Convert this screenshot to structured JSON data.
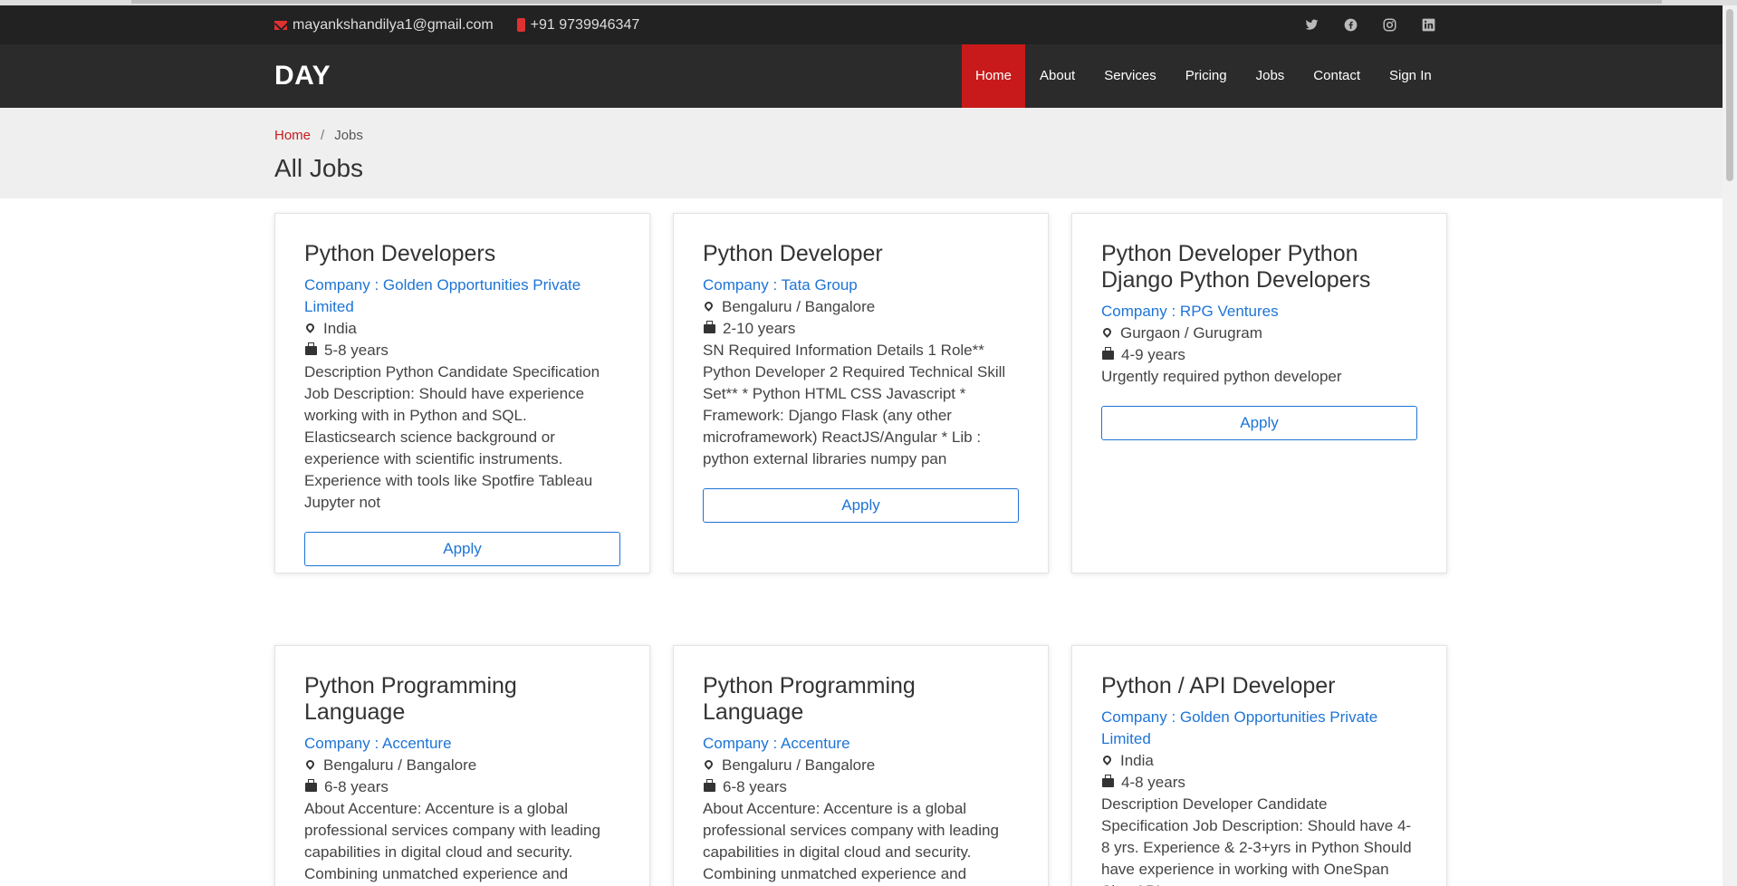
{
  "topbar": {
    "email": "mayankshandilya1@gmail.com",
    "phone": "+91 9739946347",
    "social": [
      "twitter-icon",
      "facebook-icon",
      "instagram-icon",
      "linkedin-icon"
    ]
  },
  "navbar": {
    "logo": "DAY",
    "items": [
      {
        "label": "Home",
        "active": true
      },
      {
        "label": "About"
      },
      {
        "label": "Services"
      },
      {
        "label": "Pricing"
      },
      {
        "label": "Jobs"
      },
      {
        "label": "Contact"
      },
      {
        "label": "Sign In"
      }
    ]
  },
  "breadcrumb": {
    "home": "Home",
    "separator": "/",
    "current": "Jobs"
  },
  "page_title": "All Jobs",
  "colors": {
    "accent": "#c81a1a",
    "link": "#1e74d6",
    "topbar": "#222222",
    "navbar": "#2b2b2b"
  },
  "jobs": [
    {
      "title": "Python Developers",
      "company": "Company : Golden Opportunities Private Limited",
      "location": "India",
      "experience": "5-8 years",
      "description": "Description Python Candidate Specification Job Description: Should have experience working with in Python and SQL. Elasticsearch science background or experience with scientific instruments. Experience with tools like Spotfire Tableau Jupyter not",
      "apply_label": "Apply"
    },
    {
      "title": "Python Developer",
      "company": "Company : Tata Group",
      "location": "Bengaluru / Bangalore",
      "experience": "2-10 years",
      "description": "SN Required Information Details 1 Role** Python Developer 2 Required Technical Skill Set** * Python HTML CSS Javascript * Framework: Django Flask (any other microframework) ReactJS/Angular * Lib : python external libraries numpy pan",
      "apply_label": "Apply"
    },
    {
      "title": "Python Developer Python Django Python Developers",
      "company": "Company : RPG Ventures",
      "location": "Gurgaon / Gurugram",
      "experience": "4-9 years",
      "description": "Urgently required python developer",
      "apply_label": "Apply"
    },
    {
      "title": "Python Programming Language",
      "company": "Company : Accenture",
      "location": "Bengaluru / Bangalore",
      "experience": "6-8 years",
      "description": "About Accenture: Accenture is a global professional services company with leading capabilities in digital cloud and security. Combining unmatched experience and"
    },
    {
      "title": "Python Programming Language",
      "company": "Company : Accenture",
      "location": "Bengaluru / Bangalore",
      "experience": "6-8 years",
      "description": "About Accenture: Accenture is a global professional services company with leading capabilities in digital cloud and security. Combining unmatched experience and"
    },
    {
      "title": "Python / API Developer",
      "company": "Company : Golden Opportunities Private Limited",
      "location": "India",
      "experience": "4-8 years",
      "description": "Description Developer Candidate Specification Job Description: Should have 4-8 yrs. Experience & 2-3+yrs in Python Should have experience in working with OneSpan Sign API"
    }
  ]
}
